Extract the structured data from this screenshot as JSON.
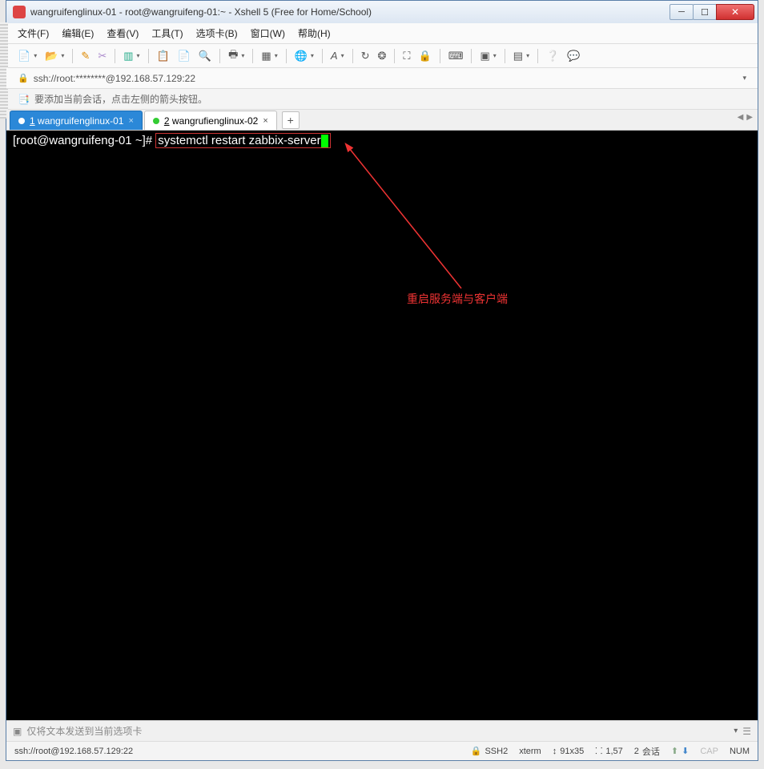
{
  "window": {
    "title": "wangruifenglinux-01 - root@wangruifeng-01:~ - Xshell 5 (Free for Home/School)"
  },
  "menus": {
    "file": "文件(F)",
    "edit": "编辑(E)",
    "view": "查看(V)",
    "tools": "工具(T)",
    "tabs": "选项卡(B)",
    "window": "窗口(W)",
    "help": "帮助(H)"
  },
  "address": {
    "text": "ssh://root:********@192.168.57.129:22"
  },
  "tip": {
    "text": "要添加当前会话，点击左侧的箭头按钮。"
  },
  "tabs": [
    {
      "num": "1",
      "label": "wangruifenglinux-01",
      "active": true
    },
    {
      "num": "2",
      "label": "wangrufienglinux-02",
      "active": false
    }
  ],
  "terminal": {
    "prompt": "[root@wangruifeng-01 ~]# ",
    "command": "systemctl restart zabbix-server",
    "annotation": "重启服务端与客户端"
  },
  "input": {
    "placeholder": "仅将文本发送到当前选项卡"
  },
  "status": {
    "path": "ssh://root@192.168.57.129:22",
    "conn": "SSH2",
    "term": "xterm",
    "size": "91x35",
    "pos": "1,57",
    "sessions_label": "会话",
    "sessions": "2",
    "cap": "CAP",
    "num": "NUM"
  }
}
